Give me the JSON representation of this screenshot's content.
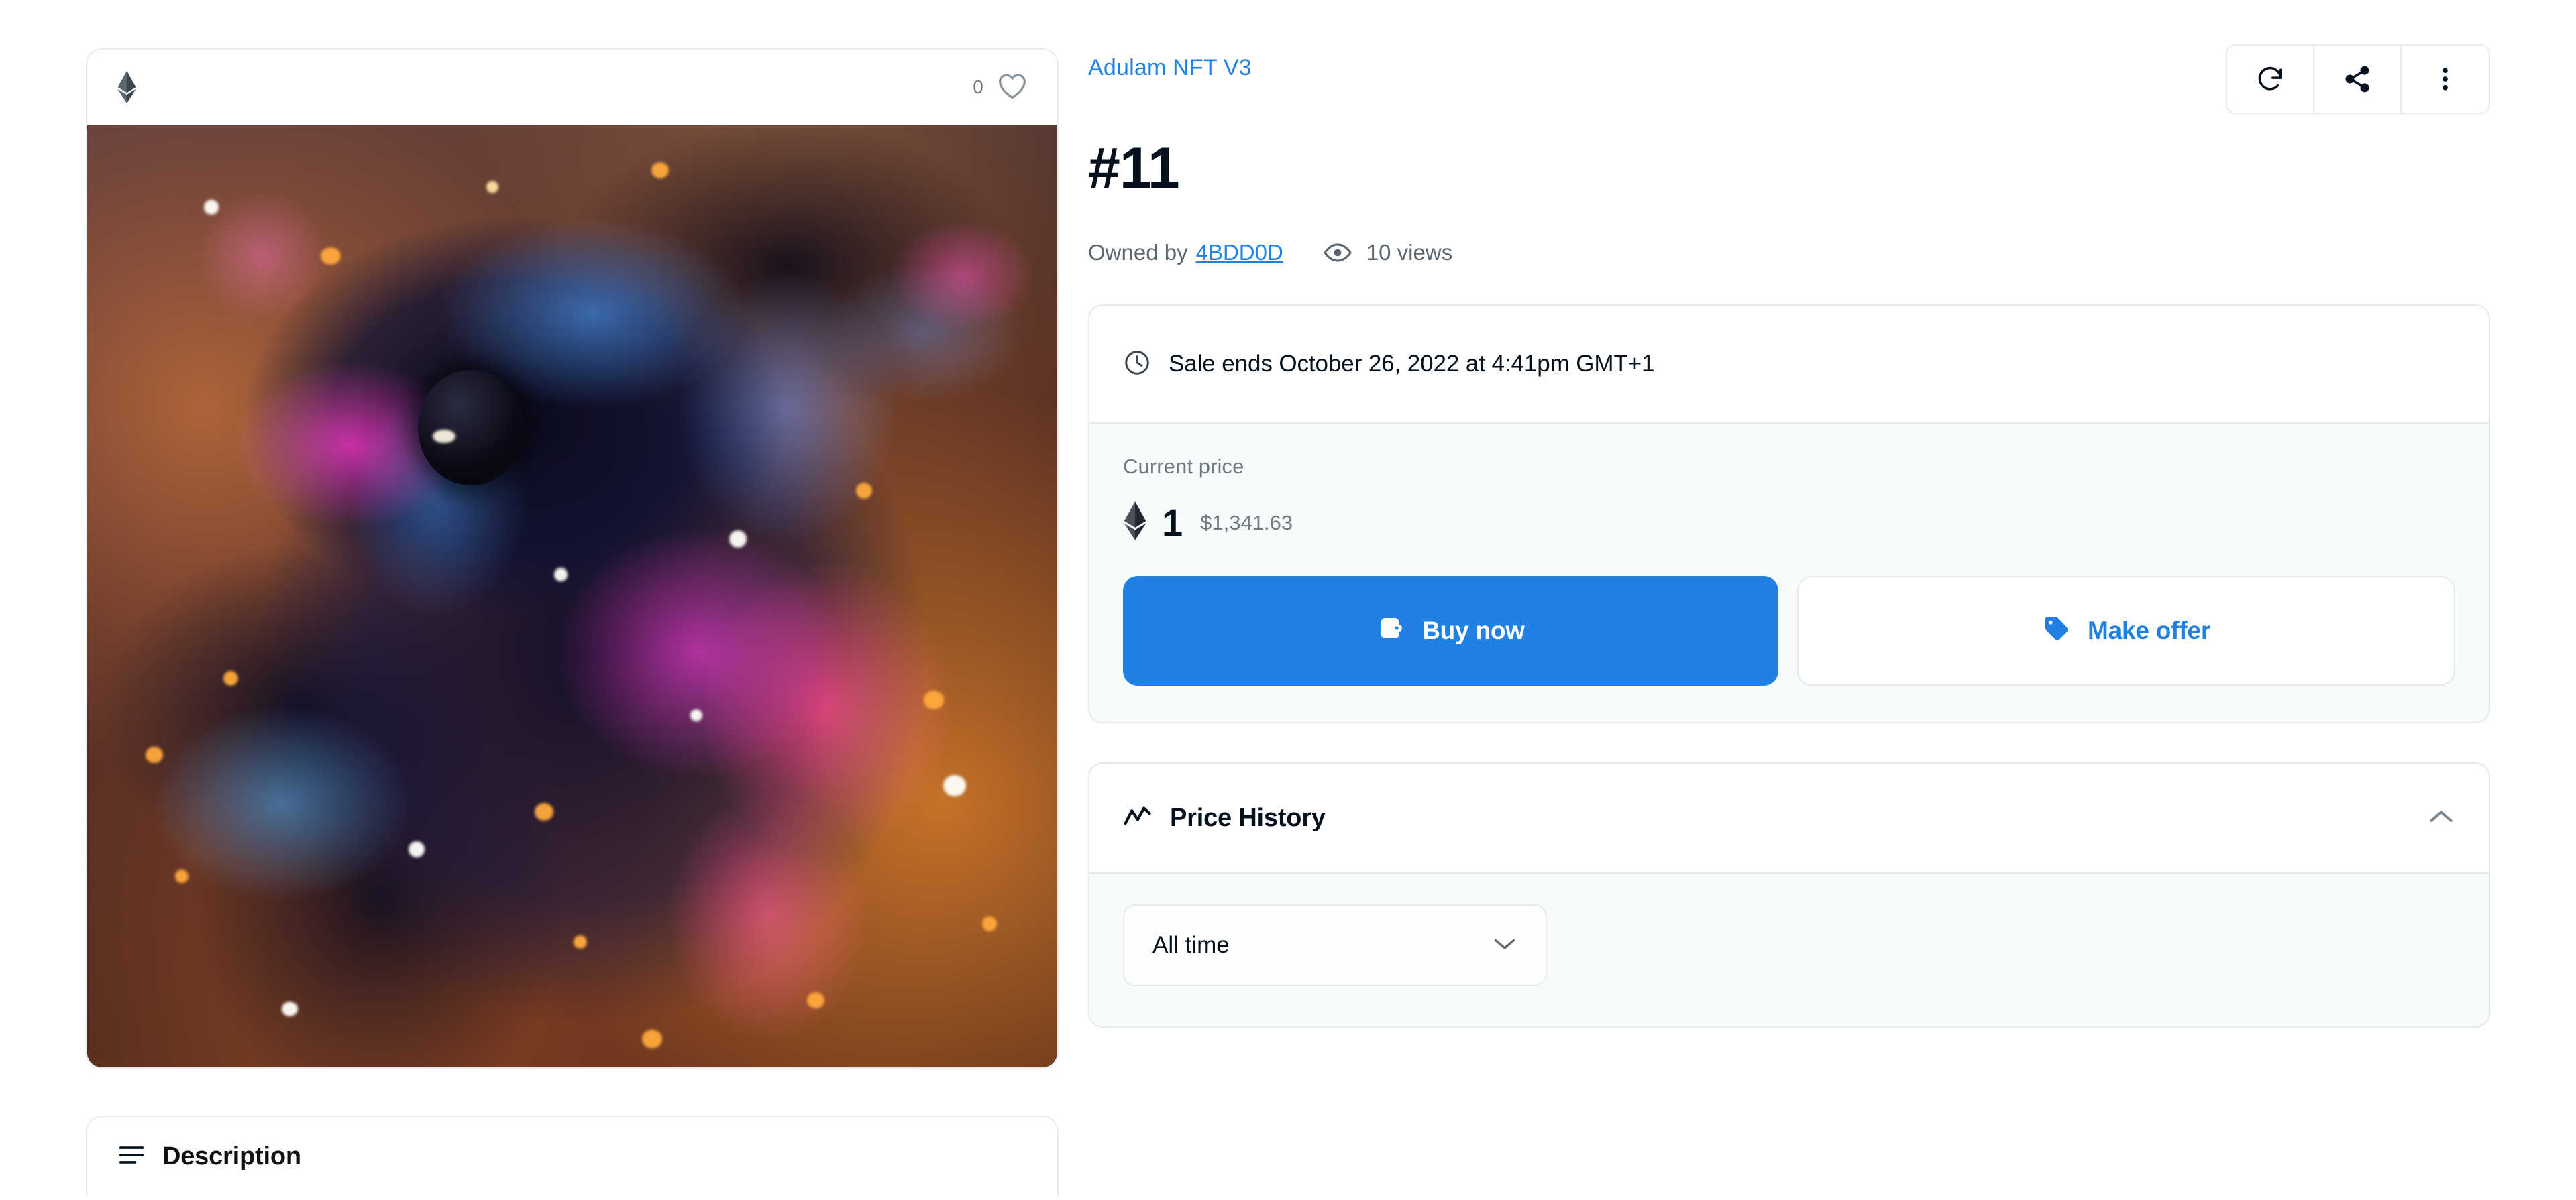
{
  "nft_card": {
    "chain_icon": "ethereum-icon",
    "favorite_count": "0",
    "favorite_icon": "heart-icon",
    "artwork_alt": "abstract-nft-artwork"
  },
  "description_card": {
    "icon": "list-lines-icon",
    "title": "Description"
  },
  "detail": {
    "collection": "Adulam NFT V3",
    "title": "#11",
    "owner_label": "Owned by",
    "owner_name": "4BDD0D",
    "views_icon": "eye-icon",
    "views": "10 views",
    "actions": [
      {
        "name": "refresh-metadata-button",
        "icon": "refresh-icon"
      },
      {
        "name": "share-button",
        "icon": "share-icon"
      },
      {
        "name": "more-options-button",
        "icon": "more-vertical-icon"
      }
    ]
  },
  "sale": {
    "clock_icon": "clock-icon",
    "sale_ends_text": "Sale ends October 26, 2022 at 4:41pm GMT+1",
    "current_price_label": "Current price",
    "price_eth": "1",
    "price_eth_icon": "ethereum-icon",
    "price_usd": "$1,341.63",
    "buy_now_label": "Buy now",
    "buy_now_icon": "wallet-icon",
    "make_offer_label": "Make offer",
    "make_offer_icon": "tag-icon"
  },
  "price_history": {
    "icon": "trend-line-icon",
    "title": "Price History",
    "collapse_icon": "chevron-up-icon",
    "range_selected": "All time",
    "range_chevron_icon": "chevron-down-icon"
  },
  "colors": {
    "accent_blue": "#2081e2",
    "text_dark": "#04111d",
    "text_muted": "#707a83",
    "border": "#e5e8eb",
    "panel_body_bg": "#f8fbfc"
  }
}
